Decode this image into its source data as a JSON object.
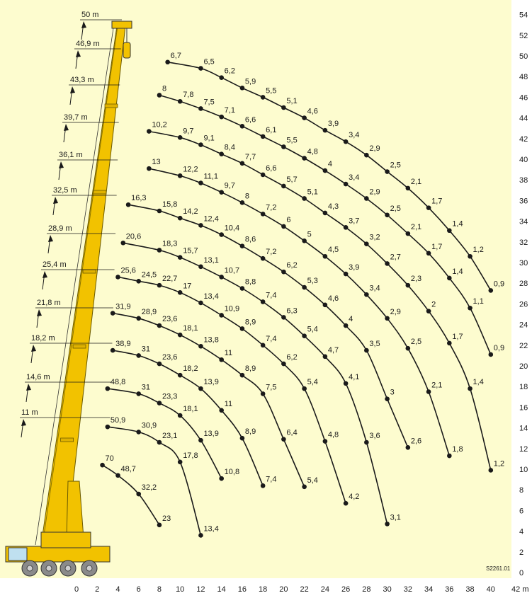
{
  "chart_data": {
    "type": "line",
    "x_unit": "m",
    "xlim": [
      0,
      42
    ],
    "ylim": [
      0,
      54
    ],
    "x_ticks": [
      "0",
      "2",
      "4",
      "6",
      "8",
      "10",
      "12",
      "14",
      "16",
      "18",
      "20",
      "22",
      "24",
      "26",
      "28",
      "30",
      "32",
      "34",
      "36",
      "38",
      "40"
    ],
    "x_unit_label": "42 m",
    "y_ticks": [
      "0",
      "2",
      "4",
      "6",
      "8",
      "10",
      "12",
      "14",
      "16",
      "18",
      "20",
      "22",
      "24",
      "26",
      "28",
      "30",
      "32",
      "34",
      "36",
      "38",
      "40",
      "42",
      "44",
      "46",
      "48",
      "50",
      "52",
      "54"
    ],
    "boom_lengths": [
      "50 m",
      "46,9 m",
      "43,3 m",
      "39,7 m",
      "36,1 m",
      "32,5 m",
      "28,9 m",
      "25,4 m",
      "21,8 m",
      "18,2 m",
      "14,6 m",
      "11 m"
    ],
    "drawing_code": "S2261.01",
    "curves": [
      {
        "points": [
          [
            8.8,
            49.4,
            "6,7"
          ],
          [
            12,
            48.8,
            "6,5"
          ],
          [
            14,
            47.9,
            "6,2"
          ],
          [
            16,
            46.9,
            "5,9"
          ],
          [
            18,
            46,
            "5,5"
          ],
          [
            20,
            45,
            "5,1"
          ],
          [
            22,
            44,
            "4,6"
          ],
          [
            24,
            42.8,
            "3,9"
          ],
          [
            26,
            41.7,
            "3,4"
          ],
          [
            28,
            40.4,
            "2,9"
          ],
          [
            30,
            38.8,
            "2,5"
          ],
          [
            32,
            37.2,
            "2,1"
          ],
          [
            34,
            35.3,
            "1,7"
          ],
          [
            36,
            33.1,
            "1,4"
          ],
          [
            38,
            30.6,
            "1,2"
          ],
          [
            40,
            27.3,
            "0,9"
          ]
        ]
      },
      {
        "points": [
          [
            8,
            46.2,
            "8"
          ],
          [
            10,
            45.6,
            "7,8"
          ],
          [
            12,
            44.9,
            "7,5"
          ],
          [
            14,
            44.1,
            "7,1"
          ],
          [
            16,
            43.2,
            "6,6"
          ],
          [
            18,
            42.2,
            "6,1"
          ],
          [
            20,
            41.2,
            "5,5"
          ],
          [
            22,
            40.1,
            "4,8"
          ],
          [
            24,
            38.9,
            "4"
          ],
          [
            26,
            37.6,
            "3,4"
          ],
          [
            28,
            36.2,
            "2,9"
          ],
          [
            30,
            34.6,
            "2,5"
          ],
          [
            32,
            32.8,
            "2,1"
          ],
          [
            34,
            30.9,
            "1,7"
          ],
          [
            36,
            28.5,
            "1,4"
          ],
          [
            38,
            25.6,
            "1,1"
          ],
          [
            40,
            21.1,
            "0,9"
          ]
        ]
      },
      {
        "points": [
          [
            7,
            42.7,
            "10,2"
          ],
          [
            10,
            42.1,
            "9,7"
          ],
          [
            12,
            41.4,
            "9,1"
          ],
          [
            14,
            40.5,
            "8,4"
          ],
          [
            16,
            39.6,
            "7,7"
          ],
          [
            18,
            38.5,
            "6,6"
          ],
          [
            20,
            37.4,
            "5,7"
          ],
          [
            22,
            36.2,
            "5,1"
          ],
          [
            24,
            34.8,
            "4,3"
          ],
          [
            26,
            33.4,
            "3,7"
          ],
          [
            28,
            31.8,
            "3,2"
          ],
          [
            30,
            29.9,
            "2,7"
          ],
          [
            32,
            27.8,
            "2,3"
          ],
          [
            34,
            25.3,
            "2"
          ],
          [
            36,
            22.2,
            "1,7"
          ],
          [
            38,
            17.8,
            "1,4"
          ],
          [
            40,
            9.9,
            "1,2"
          ]
        ]
      },
      {
        "points": [
          [
            7,
            39.1,
            "13"
          ],
          [
            10,
            38.4,
            "12,2"
          ],
          [
            12,
            37.7,
            "11,1"
          ],
          [
            14,
            36.8,
            "9,7"
          ],
          [
            16,
            35.8,
            "8"
          ],
          [
            18,
            34.7,
            "7,2"
          ],
          [
            20,
            33.5,
            "6"
          ],
          [
            22,
            32.1,
            "5"
          ],
          [
            24,
            30.6,
            "4,5"
          ],
          [
            26,
            28.9,
            "3,9"
          ],
          [
            28,
            26.9,
            "3,4"
          ],
          [
            30,
            24.6,
            "2,9"
          ],
          [
            32,
            21.7,
            "2,5"
          ],
          [
            34,
            17.5,
            "2,1"
          ],
          [
            36,
            11.3,
            "1,8"
          ]
        ]
      },
      {
        "points": [
          [
            5,
            35.6,
            "16,3"
          ],
          [
            8,
            35,
            "15,8"
          ],
          [
            10,
            34.3,
            "14,2"
          ],
          [
            12,
            33.6,
            "12,4"
          ],
          [
            14,
            32.7,
            "10,4"
          ],
          [
            16,
            31.6,
            "8,6"
          ],
          [
            18,
            30.4,
            "7,2"
          ],
          [
            20,
            29.1,
            "6,2"
          ],
          [
            22,
            27.6,
            "5,3"
          ],
          [
            24,
            25.9,
            "4,6"
          ],
          [
            26,
            23.9,
            "4"
          ],
          [
            28,
            21.5,
            "3,5"
          ],
          [
            30,
            16.8,
            "3"
          ],
          [
            32,
            12.1,
            "2,6"
          ]
        ]
      },
      {
        "points": [
          [
            4.5,
            31.9,
            "20,6"
          ],
          [
            8,
            31.2,
            "18,3"
          ],
          [
            10,
            30.5,
            "15,7"
          ],
          [
            12,
            29.6,
            "13,1"
          ],
          [
            14,
            28.6,
            "10,7"
          ],
          [
            16,
            27.5,
            "8,8"
          ],
          [
            18,
            26.2,
            "7,4"
          ],
          [
            20,
            24.7,
            "6,3"
          ],
          [
            22,
            22.9,
            "5,4"
          ],
          [
            24,
            20.9,
            "4,7"
          ],
          [
            26,
            18.3,
            "4,1"
          ],
          [
            28,
            12.6,
            "3,6"
          ],
          [
            30,
            4.7,
            "3,1"
          ]
        ]
      },
      {
        "points": [
          [
            4,
            28.6,
            "25,6"
          ],
          [
            6,
            28.2,
            "24,5"
          ],
          [
            8,
            27.8,
            "22,7"
          ],
          [
            10,
            27.1,
            "17"
          ],
          [
            12,
            26.1,
            "13,4"
          ],
          [
            14,
            24.9,
            "10,9"
          ],
          [
            16,
            23.6,
            "8,9"
          ],
          [
            18,
            22,
            "7,4"
          ],
          [
            20,
            20.2,
            "6,2"
          ],
          [
            22,
            17.8,
            "5,4"
          ],
          [
            24,
            12.7,
            "4,8"
          ],
          [
            26,
            6.7,
            "4,2"
          ]
        ]
      },
      {
        "points": [
          [
            3.5,
            25.1,
            "31,9"
          ],
          [
            6,
            24.6,
            "28,9"
          ],
          [
            8,
            23.9,
            "23,6"
          ],
          [
            10,
            23,
            "18,1"
          ],
          [
            12,
            21.9,
            "13,8"
          ],
          [
            14,
            20.6,
            "11"
          ],
          [
            16,
            19.1,
            "8,9"
          ],
          [
            18,
            17.3,
            "7,5"
          ],
          [
            20,
            12.9,
            "6,4"
          ],
          [
            22,
            8.3,
            "5,4"
          ]
        ]
      },
      {
        "points": [
          [
            3.5,
            21.5,
            "38,9"
          ],
          [
            6,
            21,
            "31"
          ],
          [
            8,
            20.2,
            "23,6"
          ],
          [
            10,
            19.1,
            "18,2"
          ],
          [
            12,
            17.8,
            "13,9"
          ],
          [
            14,
            15.7,
            "11"
          ],
          [
            16,
            13,
            "8,9"
          ],
          [
            18,
            8.4,
            "7,4"
          ]
        ]
      },
      {
        "points": [
          [
            3,
            17.8,
            "48,8"
          ],
          [
            6,
            17.3,
            "31"
          ],
          [
            8,
            16.4,
            "23,3"
          ],
          [
            10,
            15.2,
            "18,1"
          ],
          [
            12,
            12.8,
            "13,9"
          ],
          [
            14,
            9.1,
            "10,8"
          ]
        ]
      },
      {
        "points": [
          [
            3,
            14.1,
            "50,9"
          ],
          [
            6,
            13.6,
            "30,9"
          ],
          [
            8,
            12.6,
            "23,1"
          ],
          [
            10,
            10.7,
            "17,8"
          ],
          [
            12,
            3.6,
            "13,4"
          ]
        ]
      },
      {
        "points": [
          [
            2.5,
            10.4,
            "70"
          ],
          [
            4,
            9.4,
            "48,7"
          ],
          [
            6,
            7.6,
            "32,2"
          ],
          [
            8,
            4.6,
            "23"
          ]
        ]
      }
    ]
  }
}
